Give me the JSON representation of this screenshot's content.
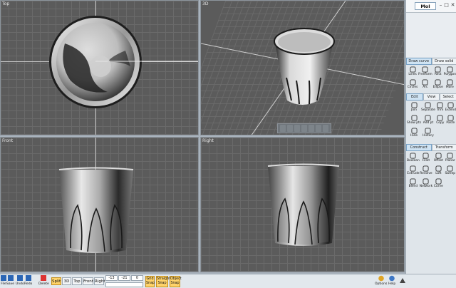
{
  "app": {
    "title": "MoI"
  },
  "viewports": {
    "top": {
      "label": "Top"
    },
    "perspective": {
      "label": "3D"
    },
    "front": {
      "label": "Front"
    },
    "right": {
      "label": "Right"
    }
  },
  "panel": {
    "curve_tabs": [
      "Draw curve",
      "Draw solid"
    ],
    "curve_tools": [
      "Lines",
      "Freeform",
      "Rect",
      "Polygon",
      "Circles",
      "Arc",
      "Ellipse",
      "More"
    ],
    "edit_tabs": [
      "Edit",
      "View",
      "Select"
    ],
    "edit_tools": [
      "Join",
      "Separate",
      "Trim",
      "Extend",
      "Show pts",
      "Add pt",
      "Copy",
      "Paste",
      "Hide",
      "History"
    ],
    "construct_tabs": [
      "Construct",
      "Transform"
    ],
    "construct_tools": [
      "Boolean",
      "Fillet",
      "Offset",
      "Planar",
      "Extrude",
      "Revolve",
      "Loft",
      "Sweep",
      "Blend",
      "Network",
      "Curve"
    ]
  },
  "bottom": {
    "file_buttons": [
      "File",
      "Save",
      "Undo",
      "Redo",
      "Delete"
    ],
    "view_buttons": [
      "Split",
      "3D",
      "Top",
      "Front",
      "Right"
    ],
    "coords": {
      "x": "-13",
      "y": "-21",
      "z": "0"
    },
    "snaps": [
      "Grid\nSnap",
      "Straight\nSnap",
      "Object\nSnap"
    ],
    "right_buttons": [
      "Options",
      "Help"
    ]
  },
  "colors": {
    "viewport_bg": "#5b5b5b",
    "panel_bg": "#dfe5ea",
    "active": "#ffd36a",
    "tab_active": "#cfe3f3"
  }
}
